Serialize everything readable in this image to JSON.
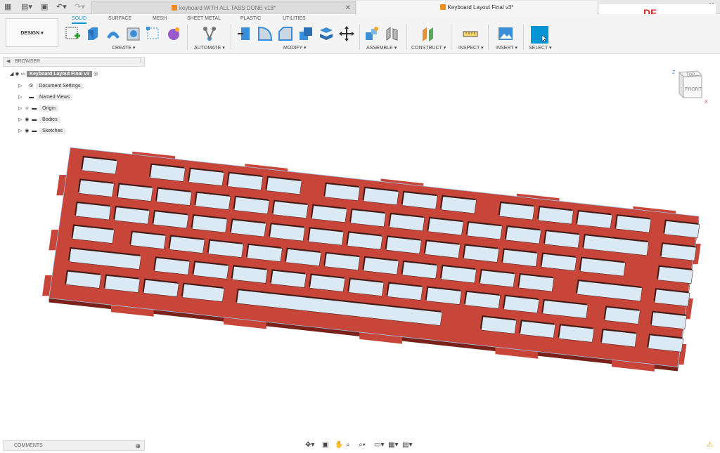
{
  "app": {
    "tabs": [
      {
        "label": "keyboard WITH ALL TABS DONE v18*",
        "close": "✕"
      },
      {
        "label": "Keyboard Layout Final v3*",
        "close": "✕"
      }
    ],
    "watermark": "DF"
  },
  "ribbon": {
    "workspace": "DESIGN",
    "tabs": [
      "SOLID",
      "SURFACE",
      "MESH",
      "SHEET METAL",
      "PLASTIC",
      "UTILITIES"
    ],
    "groups": [
      "CREATE",
      "AUTOMATE",
      "MODIFY",
      "ASSEMBLE",
      "CONSTRUCT",
      "INSPECT",
      "INSERT",
      "SELECT"
    ]
  },
  "browser": {
    "title": "BROWSER",
    "root": "Keyboard Layout Final v3",
    "items": [
      "Document Settings",
      "Named Views",
      "Origin",
      "Bodies",
      "Sketches"
    ]
  },
  "viewcube": {
    "top": "TOP",
    "front": "FRONT",
    "z": "Z",
    "x": "X"
  },
  "comments": {
    "title": "COMMENTS"
  },
  "colors": {
    "accent": "#0696d7",
    "plate": "#c8453a",
    "plate_edge": "#7a2219",
    "hole": "#dbe9f5",
    "tab_active": "#f5f5f5"
  }
}
